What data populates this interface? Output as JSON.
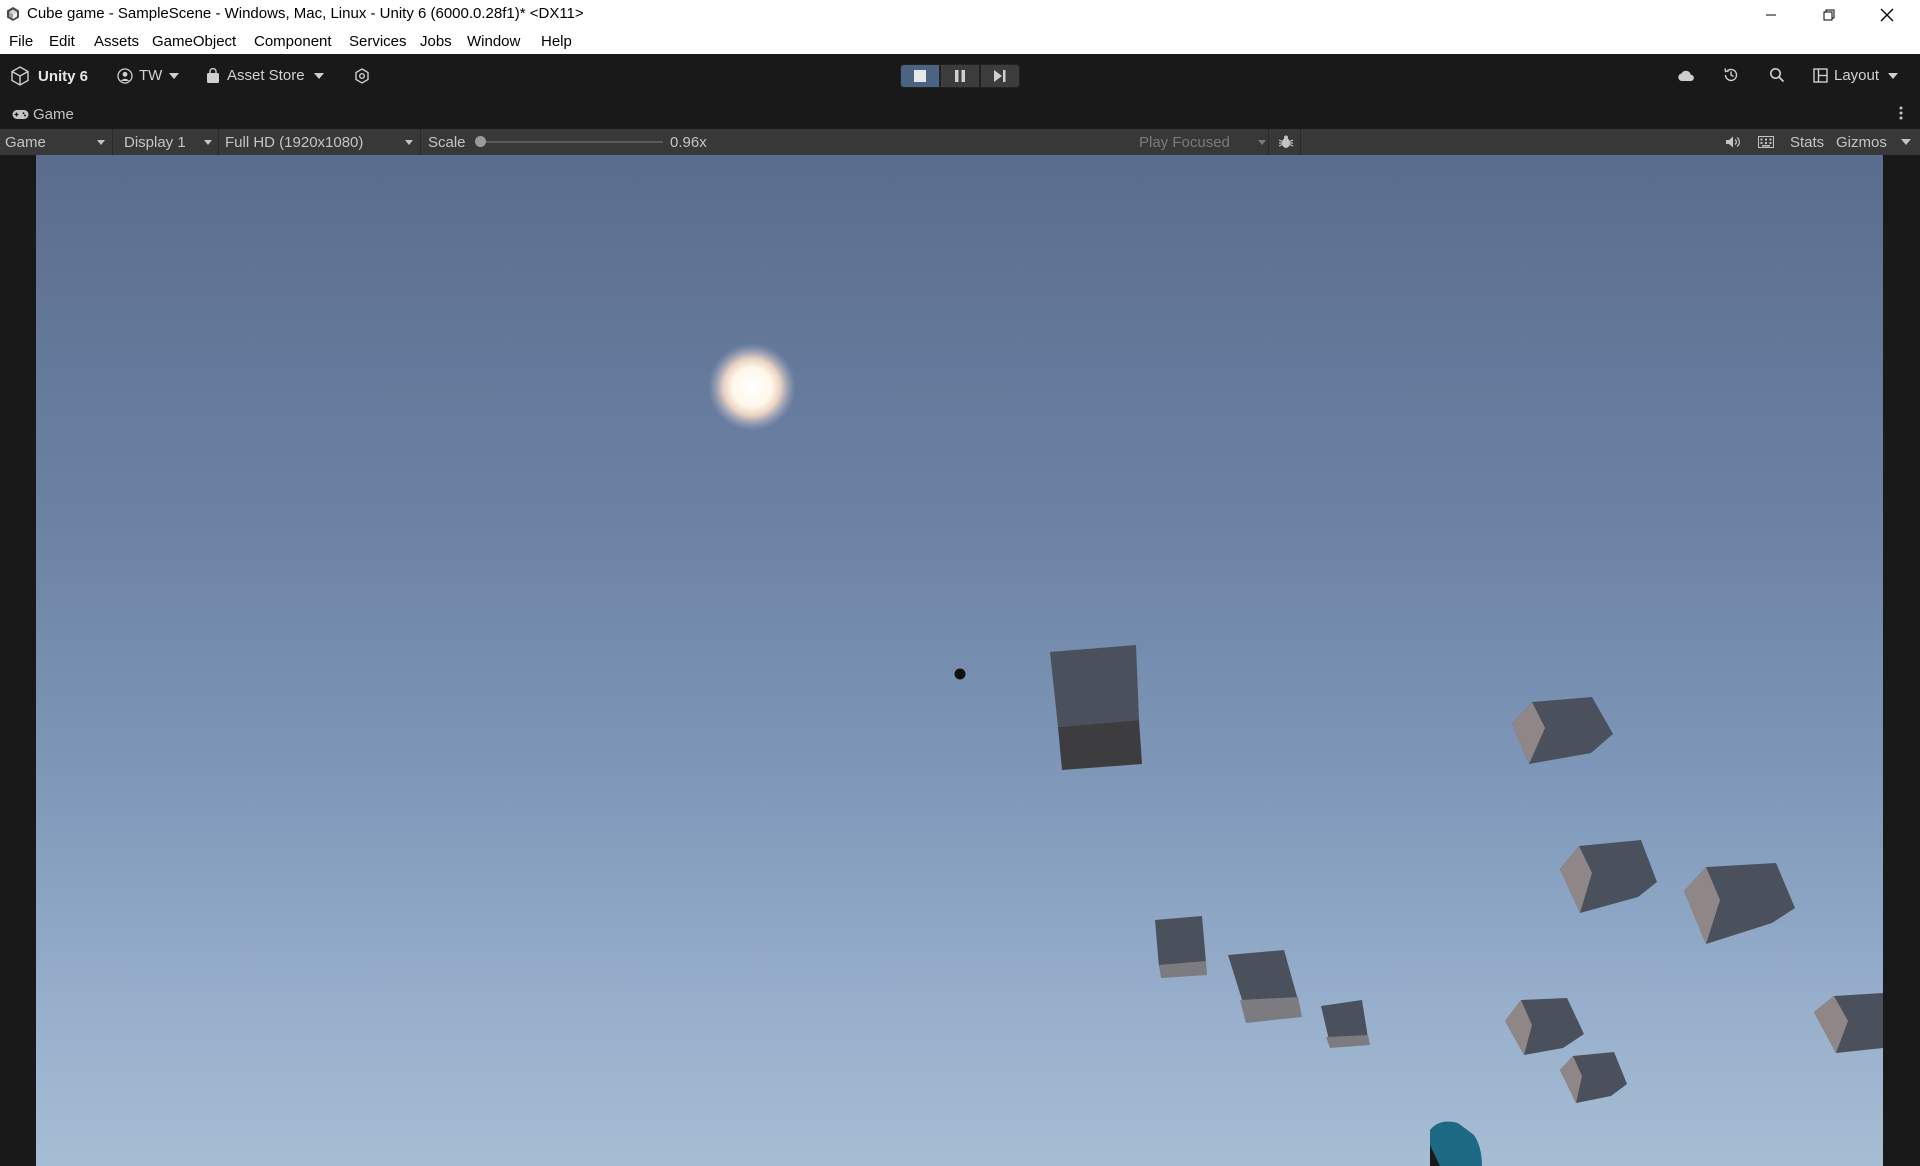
{
  "window": {
    "title": "Cube game - SampleScene - Windows, Mac, Linux - Unity 6 (6000.0.28f1)* <DX11>"
  },
  "menu": [
    "File",
    "Edit",
    "Assets",
    "GameObject",
    "Component",
    "Services",
    "Jobs",
    "Window",
    "Help"
  ],
  "toolbar": {
    "unity_label": "Unity 6",
    "account_label": "TW",
    "asset_store_label": "Asset Store",
    "layout_label": "Layout"
  },
  "tab": {
    "label": "Game"
  },
  "game_toolbar": {
    "view_mode": "Game",
    "display": "Display 1",
    "resolution": "Full HD (1920x1080)",
    "scale_label": "Scale",
    "scale_value": "0.96x",
    "scale_fraction": 0.0,
    "play_focused": "Play Focused",
    "stats": "Stats",
    "gizmos": "Gizmos"
  },
  "colors": {
    "editor_bg": "#191919",
    "toolbar_bg": "#383838",
    "play_active": "#4a6482",
    "cube_top": "#4a505c",
    "cube_side": "#8a8282"
  }
}
